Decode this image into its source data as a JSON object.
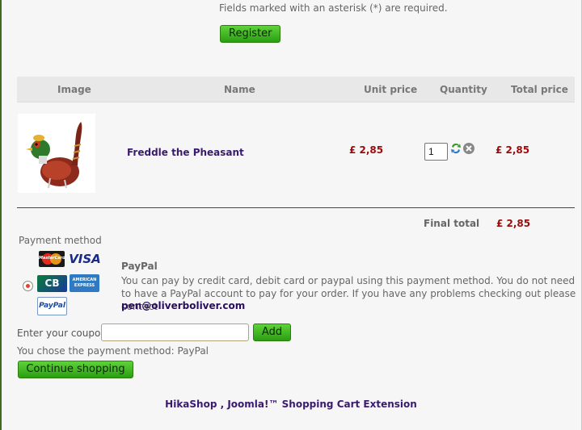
{
  "form": {
    "required_note": "Fields marked with an asterisk (*) are required.",
    "register_label": "Register"
  },
  "cart": {
    "columns": [
      "Image",
      "Name",
      "Unit price",
      "Quantity",
      "Total price"
    ],
    "items": [
      {
        "name": "Freddle the Pheasant",
        "unit_price": "£ 2,85",
        "quantity": "1",
        "total_price": "£ 2,85",
        "image_icon": "pheasant-toy-image"
      }
    ],
    "final_total_label": "Final total",
    "final_total_value": "£ 2,85"
  },
  "payment": {
    "section_label": "Payment method",
    "method_title": "PayPal",
    "description": "You can pay by credit card, debit card or paypal using this payment method. You do not need to have a PayPal account to pay for your order. If you have any problems checking out please contact",
    "email": "pen@oliverboliver.com",
    "card_logos": [
      "MasterCard",
      "VISA",
      "CB",
      "AMERICAN EXPRESS",
      "PayPal"
    ]
  },
  "coupon": {
    "label": "Enter your coupon",
    "value": "",
    "add_label": "Add"
  },
  "chosen_text": "You chose the payment method: PayPal",
  "continue_label": "Continue shopping",
  "footer_text": "HikaShop , Joomla!™ Shopping Cart Extension",
  "colors": {
    "price": "#9a0c0c",
    "link": "#3a1a6e",
    "button_green": "#2a9e12"
  }
}
